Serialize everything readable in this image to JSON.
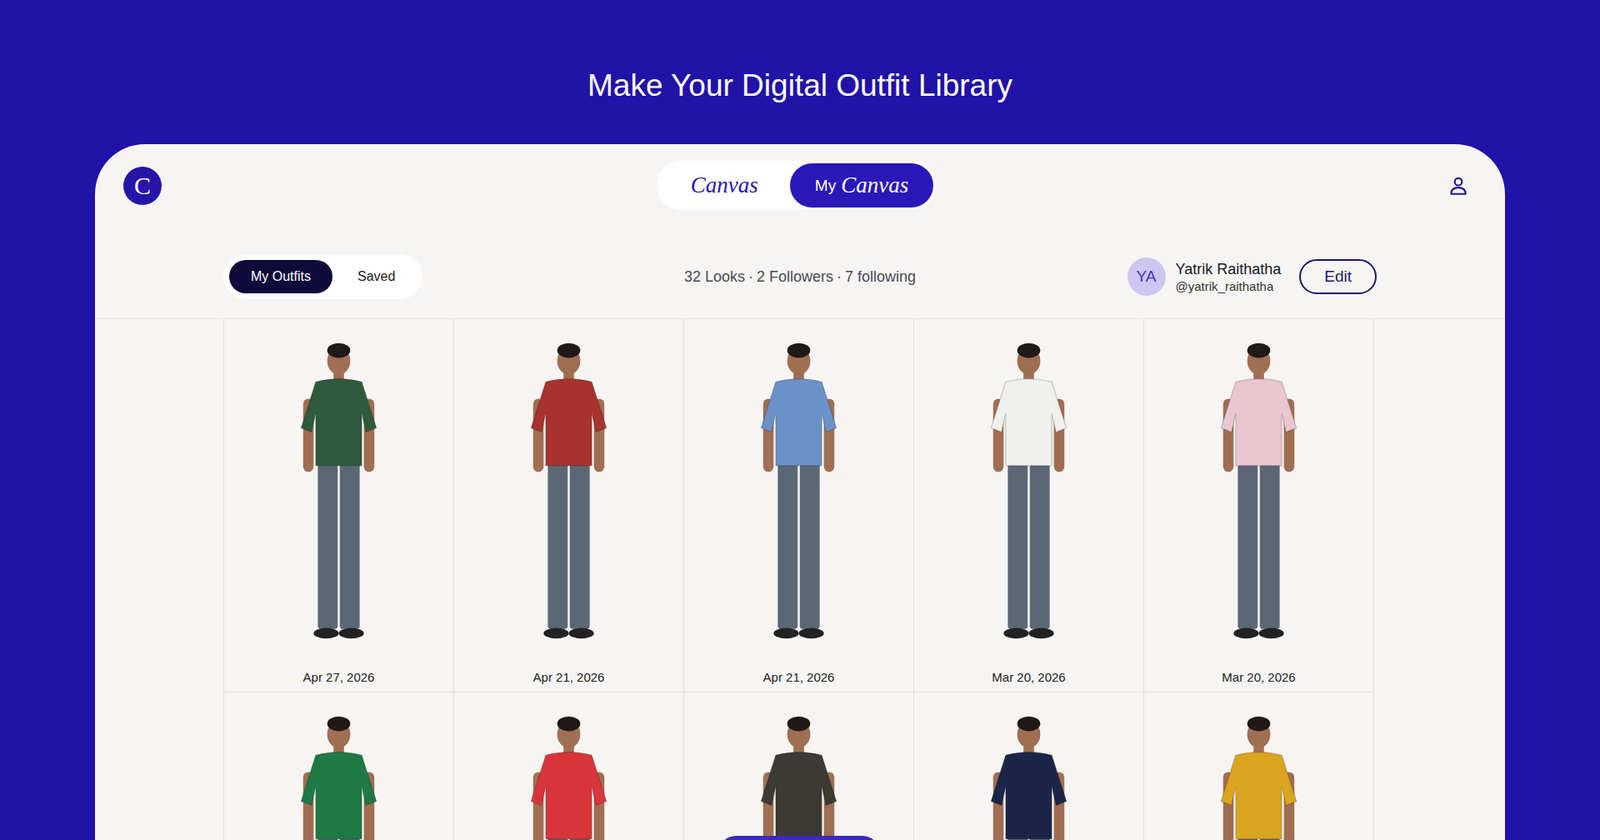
{
  "page": {
    "title": "Make Your Digital Outfit Library"
  },
  "logo": {
    "letter": "C"
  },
  "tabs": [
    {
      "prefix": "",
      "label": "Canvas",
      "selected": false
    },
    {
      "prefix": "My",
      "label": "Canvas",
      "selected": true
    }
  ],
  "views": [
    {
      "label": "My Outfits",
      "selected": true
    },
    {
      "label": "Saved",
      "selected": false
    }
  ],
  "stats": {
    "items": [
      "32 Looks",
      "2 Followers",
      "7 following"
    ],
    "separator": "·"
  },
  "profile": {
    "initials": "YA",
    "name": "Yatrik Raithatha",
    "handle": "@yatrik_raithatha",
    "button": "Edit"
  },
  "outfits": [
    {
      "date": "Apr 27, 2026",
      "color": "#2f5a3c"
    },
    {
      "date": "Apr 21, 2026",
      "color": "#a8322c"
    },
    {
      "date": "Apr 21, 2026",
      "color": "#6b92c8"
    },
    {
      "date": "Mar 20, 2026",
      "color": "#f0f0ee"
    },
    {
      "date": "Mar 20, 2026",
      "color": "#e9c6d0"
    },
    {
      "color": "#1e7a45"
    },
    {
      "color": "#d8353a"
    },
    {
      "color": "#3d3a36"
    },
    {
      "color": "#1a2548"
    },
    {
      "color": "#d9a520"
    }
  ]
}
